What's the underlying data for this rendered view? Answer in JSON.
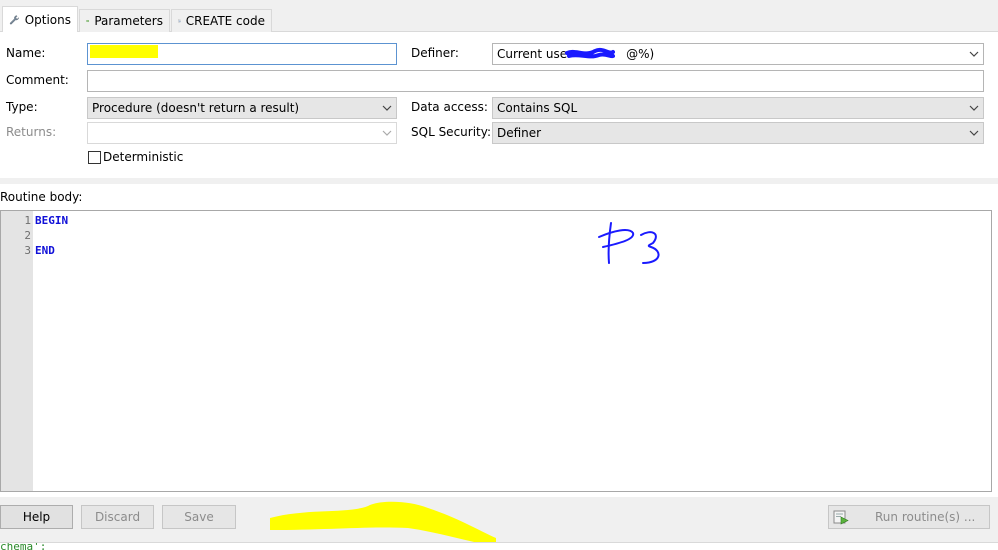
{
  "tabs": [
    {
      "label": "Options",
      "icon": "wrench-icon"
    },
    {
      "label": "Parameters",
      "icon": "double-arrow-icon"
    },
    {
      "label": "CREATE code",
      "icon": "code-document-icon"
    }
  ],
  "options": {
    "name_label": "Name:",
    "name_value": "",
    "comment_label": "Comment:",
    "comment_value": "",
    "type_label": "Type:",
    "type_value": "Procedure (doesn't return a result)",
    "returns_label": "Returns:",
    "returns_value": "",
    "deterministic_label": "Deterministic",
    "deterministic_checked": false,
    "definer_label": "Definer:",
    "definer_value_prefix": "Current user ",
    "definer_value_suffix": "@%)",
    "data_access_label": "Data access:",
    "data_access_value": "Contains SQL",
    "sql_security_label": "SQL Security:",
    "sql_security_value": "Definer"
  },
  "routine": {
    "body_label": "Routine body:",
    "line_numbers": [
      "1",
      "2",
      "3"
    ],
    "lines": [
      "BEGIN",
      "",
      "END"
    ],
    "annotation": "P3"
  },
  "buttons": {
    "help": "Help",
    "discard": "Discard",
    "save": "Save",
    "run": "Run routine(s) ..."
  },
  "status_text": "chema';",
  "colors": {
    "highlight": "#ffff00",
    "code_keyword": "#1010d8",
    "redaction": "#1a1aff"
  }
}
